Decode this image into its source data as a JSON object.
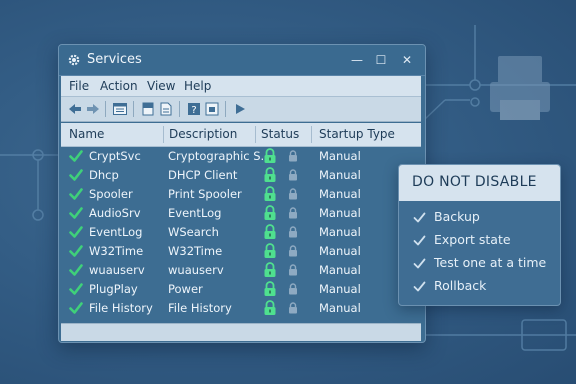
{
  "window": {
    "title": "Services",
    "controls": {
      "minimize": "—",
      "maximize": "☐",
      "close": "✕"
    }
  },
  "menu": [
    "File",
    "Action",
    "View",
    "Help"
  ],
  "toolbar_icons": [
    "back-arrow-icon",
    "forward-arrow-icon",
    "console-icon",
    "properties-icon",
    "export-icon",
    "help-icon",
    "view-icon",
    "play-icon"
  ],
  "columns": [
    "Name",
    "Description",
    "Status",
    "Startup Type"
  ],
  "services": [
    {
      "name": "CryptSvc",
      "description": "Cryptographic S...",
      "startup": "Manual"
    },
    {
      "name": "Dhcp",
      "description": "DHCP Client",
      "startup": "Manual"
    },
    {
      "name": "Spooler",
      "description": "Print Spooler",
      "startup": "Manual"
    },
    {
      "name": "AudioSrv",
      "description": "EventLog",
      "startup": "Manual"
    },
    {
      "name": "EventLog",
      "description": "WSearch",
      "startup": "Manual"
    },
    {
      "name": "W32Time",
      "description": "W32Time",
      "startup": "Manual"
    },
    {
      "name": "wuauserv",
      "description": "wuauserv",
      "startup": "Manual"
    },
    {
      "name": "PlugPlay",
      "description": "Power",
      "startup": "Manual"
    },
    {
      "name": "File History",
      "description": "File History",
      "startup": "Manual"
    }
  ],
  "callout": {
    "title": "DO NOT DISABLE",
    "items": [
      "Backup",
      "Export state",
      "Test one at a time",
      "Rollback"
    ]
  },
  "colors": {
    "check_green": "#3fd07a",
    "lock_green": "#4fe08f",
    "header_bg": "#d6e3ee"
  }
}
